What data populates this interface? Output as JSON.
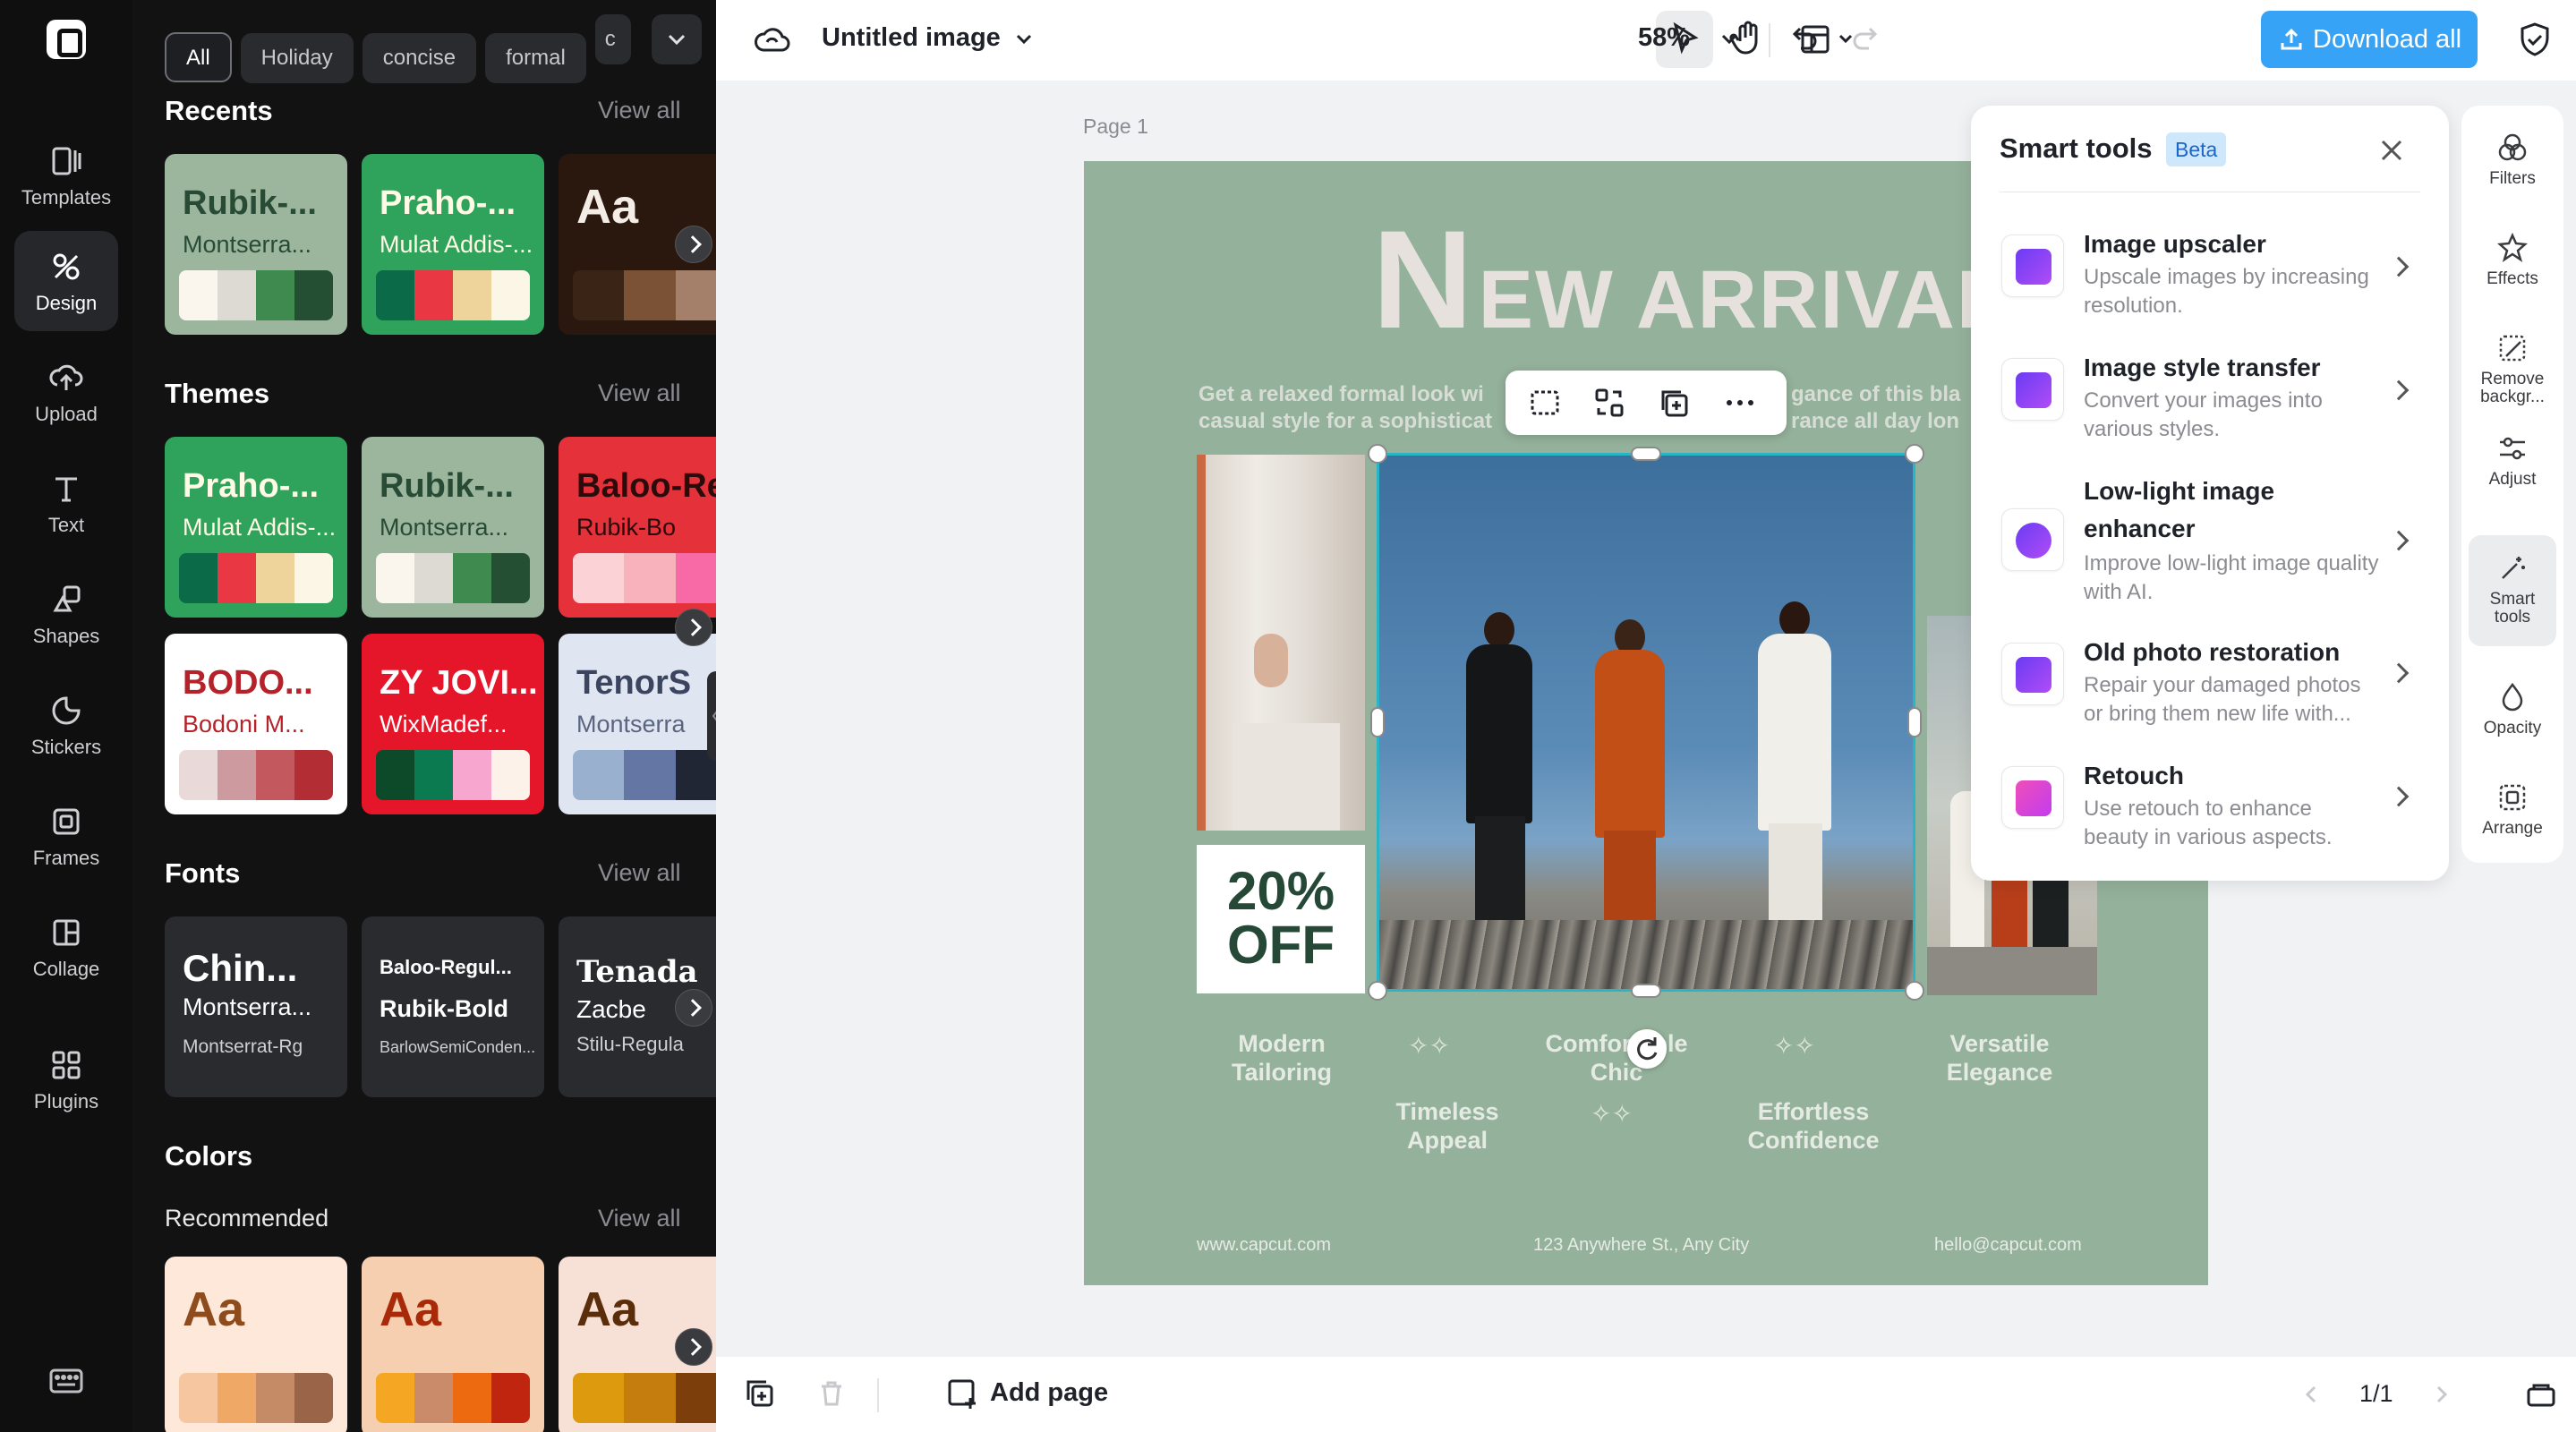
{
  "rail": {
    "items": [
      {
        "label": "Templates",
        "icon": "template-icon"
      },
      {
        "label": "Design",
        "icon": "design-icon",
        "active": true
      },
      {
        "label": "Upload",
        "icon": "upload-icon"
      },
      {
        "label": "Text",
        "icon": "text-icon"
      },
      {
        "label": "Shapes",
        "icon": "shapes-icon"
      },
      {
        "label": "Stickers",
        "icon": "stickers-icon"
      },
      {
        "label": "Frames",
        "icon": "frames-icon"
      },
      {
        "label": "Collage",
        "icon": "collage-icon"
      },
      {
        "label": "Plugins",
        "icon": "plugins-icon"
      }
    ]
  },
  "panel": {
    "chips": [
      "All",
      "Holiday",
      "concise",
      "formal",
      "c"
    ],
    "view_all": "View all",
    "recents": {
      "title": "Recents",
      "cards": [
        {
          "t1": "Rubik-...",
          "t2": "Montserra...",
          "bg": "#9cb59d",
          "c1": "#274b35",
          "c2": "#274b35",
          "swatches": [
            "#faf6ee",
            "#dcdad3",
            "#3f8a4f",
            "#254f33"
          ]
        },
        {
          "t1": "Praho-...",
          "t2": "Mulat Addis-...",
          "bg": "#2fa35c",
          "c1": "#fff9e6",
          "c2": "#fff9e6",
          "swatches": [
            "#0b6a47",
            "#ea3744",
            "#eed39a",
            "#fcf6e6"
          ]
        },
        {
          "t1": "Aa",
          "t2": "",
          "bg": "#2a170d",
          "c1": "#f3ede5",
          "c2": "#f3ede5",
          "swatches": [
            "#3a2416",
            "#7b5235",
            "#a4806a"
          ]
        }
      ]
    },
    "themes": {
      "title": "Themes",
      "cards": [
        {
          "t1": "Praho-...",
          "t2": "Mulat Addis-...",
          "bg": "#2fa35c",
          "c1": "#fff9e6",
          "c2": "#fff9e6",
          "swatches": [
            "#0b6a47",
            "#ea3744",
            "#eed39a",
            "#fcf6e6"
          ]
        },
        {
          "t1": "Rubik-...",
          "t2": "Montserra...",
          "bg": "#9cb59d",
          "c1": "#274b35",
          "c2": "#274b35",
          "swatches": [
            "#faf6ee",
            "#dcdad3",
            "#3f8a4f",
            "#254f33"
          ]
        },
        {
          "t1": "Baloo-Regu",
          "t2": "Rubik-Bo",
          "bg": "#e5323a",
          "c1": "#2b0b0b",
          "c2": "#2b0b0b",
          "swatches": [
            "#fbd2d6",
            "#f8b2bb",
            "#f76aa6"
          ]
        },
        {
          "t1": "BODO...",
          "t2": "Bodoni M...",
          "bg": "#ffffff",
          "c1": "#b5222a",
          "c2": "#b5222a",
          "swatches": [
            "#e9d9d9",
            "#cd9a9f",
            "#c4585f",
            "#b22d34"
          ]
        },
        {
          "t1": "ZY JOVI...",
          "t2": "WixMadef...",
          "bg": "#e6162a",
          "c1": "#ffffff",
          "c2": "#ffffff",
          "swatches": [
            "#0d4a2a",
            "#0b7a51",
            "#f7a6cf",
            "#fcf2ea"
          ]
        },
        {
          "t1": "TenorS",
          "t2": "Montserra",
          "bg": "#dfe6f1",
          "c1": "#3b4560",
          "c2": "#5b6580",
          "swatches": [
            "#9ab0cf",
            "#6477a4",
            "#202633"
          ]
        }
      ]
    },
    "fonts": {
      "title": "Fonts",
      "cards": [
        {
          "a": "Chin...",
          "b": "Montserra...",
          "c": "Montserrat-Rg"
        },
        {
          "a": "Baloo-Regul...",
          "b": "Rubik-Bold",
          "c": "BarlowSemiConden..."
        },
        {
          "a": "Tenada",
          "b": "Zacbe",
          "c": "Stilu-Regula"
        }
      ]
    },
    "colors": {
      "title": "Colors",
      "recommended": "Recommended",
      "cards": [
        {
          "t1": "Aa",
          "bg": "#fde8d9",
          "c1": "#8e4b1c",
          "swatches": [
            "#f6c6a0",
            "#f0a866",
            "#c58a66",
            "#9a6448"
          ]
        },
        {
          "t1": "Aa",
          "bg": "#f6ceb0",
          "c1": "#a92a08",
          "swatches": [
            "#f5a623",
            "#c98b69",
            "#ee6a10",
            "#c0260f"
          ]
        },
        {
          "t1": "Aa",
          "bg": "#f7e0d6",
          "c1": "#5a2e0a",
          "swatches": [
            "#de9a0f",
            "#c57e0d",
            "#7c3e0a"
          ]
        }
      ]
    }
  },
  "topbar": {
    "title": "Untitled image",
    "zoom": "58%",
    "download_label": "Download all"
  },
  "canvas": {
    "page_label": "Page 1",
    "poster": {
      "headline_first": "N",
      "headline_rest": "EW ARRIVAL",
      "sub_left_1": "Get a relaxed formal look wi",
      "sub_left_2": "casual style for a sophisticat",
      "sub_right_1": "gance of this bla",
      "sub_right_2": "rance all day lon",
      "offer_1": "20%",
      "offer_2": "OFF",
      "features": [
        {
          "l1": "Modern",
          "l2": "Tailoring"
        },
        {
          "l1": "Timeless",
          "l2": "Appeal"
        },
        {
          "l1": "Comfortable",
          "l2": "Chic"
        },
        {
          "l1": "Effortless",
          "l2": "Confidence"
        },
        {
          "l1": "Versatile",
          "l2": "Elegance"
        }
      ],
      "footer_left": "www.capcut.com",
      "footer_mid": "123 Anywhere St., Any City",
      "footer_right": "hello@capcut.com"
    }
  },
  "smart_tools": {
    "title": "Smart tools",
    "badge": "Beta",
    "tools": [
      {
        "name": "Image upscaler",
        "desc": "Upscale images by increasing resolution.",
        "icon": "upscale-icon"
      },
      {
        "name": "Image style transfer",
        "desc": "Convert your images into various styles.",
        "icon": "style-transfer-icon"
      },
      {
        "name": "Low-light image enhancer",
        "desc": "Improve low-light image quality with AI.",
        "icon": "moon-icon"
      },
      {
        "name": "Old photo restoration",
        "desc": "Repair your damaged photos or bring them new life with...",
        "icon": "restore-icon"
      },
      {
        "name": "Retouch",
        "desc": "Use retouch to enhance beauty in various aspects.",
        "icon": "retouch-icon"
      }
    ]
  },
  "right_rail": {
    "items": [
      {
        "label": "Filters"
      },
      {
        "label": "Effects"
      },
      {
        "label": "Remove backgr..."
      },
      {
        "label": "Adjust"
      },
      {
        "label": "Smart tools",
        "active": true
      },
      {
        "label": "Opacity"
      },
      {
        "label": "Arrange"
      }
    ]
  },
  "bottombar": {
    "add_page": "Add page",
    "pager": "1/1"
  }
}
